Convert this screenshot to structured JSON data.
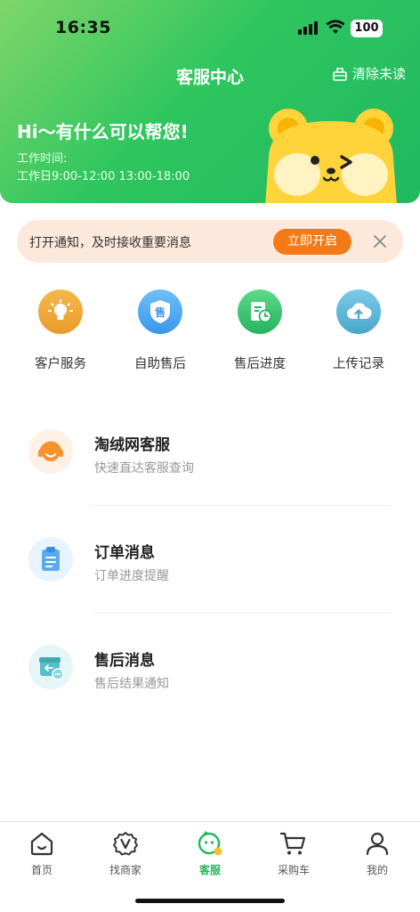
{
  "status_bar": {
    "time": "16:35",
    "battery": "100"
  },
  "header": {
    "title": "客服中心",
    "clear_unread": "清除未读",
    "greeting": "Hi～有什么可以帮您!",
    "work_time_label": "工作时间:",
    "work_time_value": "工作日9:00-12:00   13:00-18:00"
  },
  "notice": {
    "text": "打开通知，及时接收重要消息",
    "button": "立即开启"
  },
  "quick_actions": [
    {
      "label": "客户服务",
      "icon": "lightbulb-icon",
      "color": "#f0a73a"
    },
    {
      "label": "自助售后",
      "icon": "shield-sale-icon",
      "color": "#4ca9f2"
    },
    {
      "label": "售后进度",
      "icon": "progress-clock-icon",
      "color": "#35c26e"
    },
    {
      "label": "上传记录",
      "icon": "cloud-upload-icon",
      "color": "#5cb7d6"
    }
  ],
  "messages": [
    {
      "title": "淘绒网客服",
      "subtitle": "快速直达客服查询",
      "icon": "headset-agent-icon"
    },
    {
      "title": "订单消息",
      "subtitle": "订单进度提醒",
      "icon": "clipboard-icon"
    },
    {
      "title": "售后消息",
      "subtitle": "售后结果通知",
      "icon": "return-box-icon"
    }
  ],
  "tabbar": [
    {
      "label": "首页",
      "icon": "home-icon"
    },
    {
      "label": "找商家",
      "icon": "merchant-icon"
    },
    {
      "label": "客服",
      "icon": "service-icon",
      "active": true
    },
    {
      "label": "采购车",
      "icon": "cart-icon"
    },
    {
      "label": "我的",
      "icon": "user-icon"
    }
  ],
  "colors": {
    "primary_green": "#1fb860",
    "orange": "#f47a17",
    "notice_bg": "#fde8dc"
  }
}
